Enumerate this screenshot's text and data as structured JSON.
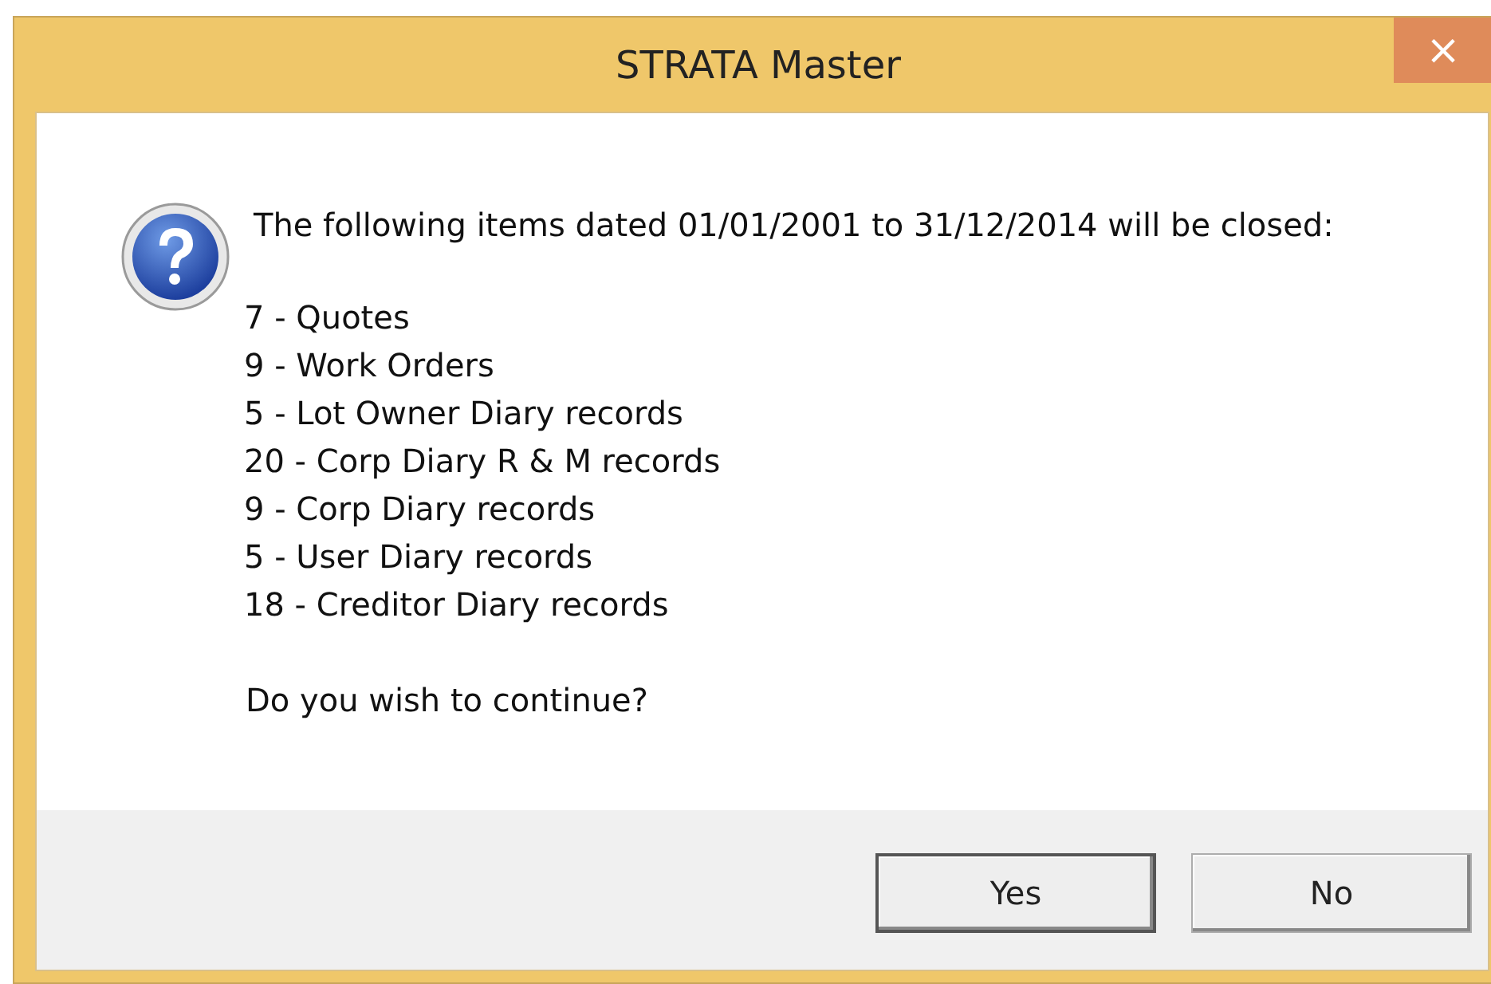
{
  "window": {
    "title": "STRATA Master",
    "close": "×"
  },
  "message": {
    "heading": "The following items dated 01/01/2001 to 31/12/2014 will be closed:",
    "items": [
      "7 - Quotes",
      "9 - Work Orders",
      "5 - Lot Owner Diary records",
      "20 - Corp Diary R & M records",
      "9 - Corp Diary records",
      "5 - User Diary records",
      "18 - Creditor Diary records"
    ],
    "question": "Do you wish to continue?"
  },
  "buttons": [
    {
      "label": "Yes",
      "default": true
    },
    {
      "label": "No",
      "default": false
    }
  ]
}
